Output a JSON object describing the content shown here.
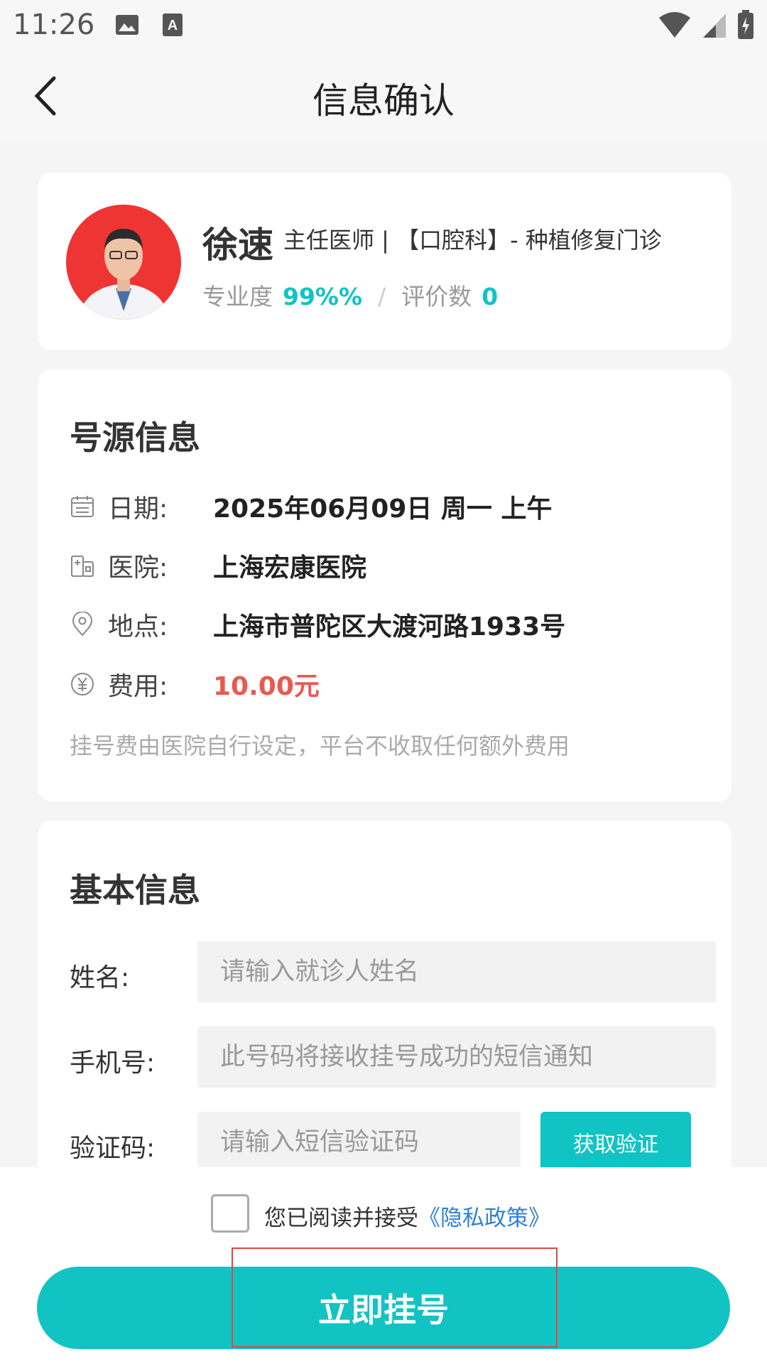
{
  "status_bar": {
    "time": "11:26",
    "icons": [
      "image-icon",
      "a-icon",
      "wifi-icon",
      "signal-icon",
      "battery-icon"
    ]
  },
  "header": {
    "title": "信息确认",
    "back_icon": "chevron-left-icon"
  },
  "doctor": {
    "name": "徐速",
    "title": "主任医师 | 【口腔科】- 种植修复门诊",
    "professional_label": "专业度",
    "professional_value": "99%%",
    "separator": "/",
    "reviews_label": "评价数",
    "reviews_value": "0"
  },
  "schedule": {
    "title": "号源信息",
    "rows": [
      {
        "icon": "calendar-icon",
        "label": "日期:",
        "value": "2025年06月09日 周一 上午"
      },
      {
        "icon": "hospital-icon",
        "label": "医院:",
        "value": "上海宏康医院"
      },
      {
        "icon": "location-icon",
        "label": "地点:",
        "value": "上海市普陀区大渡河路1933号"
      },
      {
        "icon": "yuan-icon",
        "label": "费用:",
        "value": "10.00元"
      }
    ],
    "note": "挂号费由医院自行设定，平台不收取任何额外费用"
  },
  "basic_info": {
    "title": "基本信息",
    "name_label": "姓名:",
    "name_placeholder": "请输入就诊人姓名",
    "phone_label": "手机号:",
    "phone_placeholder": "此号码将接收挂号成功的短信通知",
    "code_label": "验证码:",
    "code_placeholder": "请输入短信验证码",
    "code_button": "获取验证"
  },
  "footer": {
    "agree_text": "您已阅读并接受",
    "privacy_link": "《隐私政策》",
    "submit_button": "立即挂号"
  },
  "colors": {
    "accent": "#12c3c3",
    "fee": "#e85a4f",
    "link": "#2f7fdc",
    "avatar_bg": "#ef3434"
  }
}
